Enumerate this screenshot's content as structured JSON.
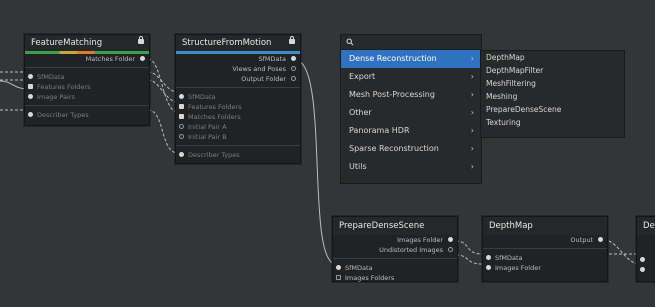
{
  "nodes": {
    "feature_matching": {
      "title": "FeatureMatching",
      "outputs": [
        "Matches Folder"
      ],
      "inputs": [
        "SfMData",
        "Features Folders",
        "Image Pairs"
      ],
      "extra_inputs": [
        "Describer Types"
      ]
    },
    "structure_from_motion": {
      "title": "StructureFromMotion",
      "outputs": [
        "SfMData",
        "Views and Poses",
        "Output Folder"
      ],
      "inputs": [
        "SfMData",
        "Features Folders",
        "Matches Folders",
        "Initial Pair A",
        "Initial Pair B"
      ],
      "extra_inputs": [
        "Describer Types"
      ]
    },
    "prepare_dense_scene": {
      "title": "PrepareDenseScene",
      "outputs": [
        "Images Folder",
        "Undistorted Images"
      ],
      "inputs": [
        "SfMData",
        "Images Folders"
      ]
    },
    "depth_map": {
      "title": "DepthMap",
      "outputs": [
        "Output"
      ],
      "inputs": [
        "SfMData",
        "Images Folder"
      ]
    },
    "next_node": {
      "title": "De"
    }
  },
  "menu": {
    "search_icon": "search-icon",
    "items": [
      {
        "label": "Dense Reconstruction",
        "active": true
      },
      {
        "label": "Export"
      },
      {
        "label": "Mesh Post-Processing"
      },
      {
        "label": "Other"
      },
      {
        "label": "Panorama HDR"
      },
      {
        "label": "Sparse Reconstruction"
      },
      {
        "label": "Utils"
      }
    ],
    "chevron": "›"
  },
  "submenu": {
    "items": [
      "DepthMap",
      "DepthMapFilter",
      "MeshFiltering",
      "Meshing",
      "PrepareDenseScene",
      "Texturing"
    ]
  },
  "colors": {
    "canvas": "#333536",
    "menu_active": "#2f72c2",
    "sfm_bar": "#3b8fc4"
  }
}
